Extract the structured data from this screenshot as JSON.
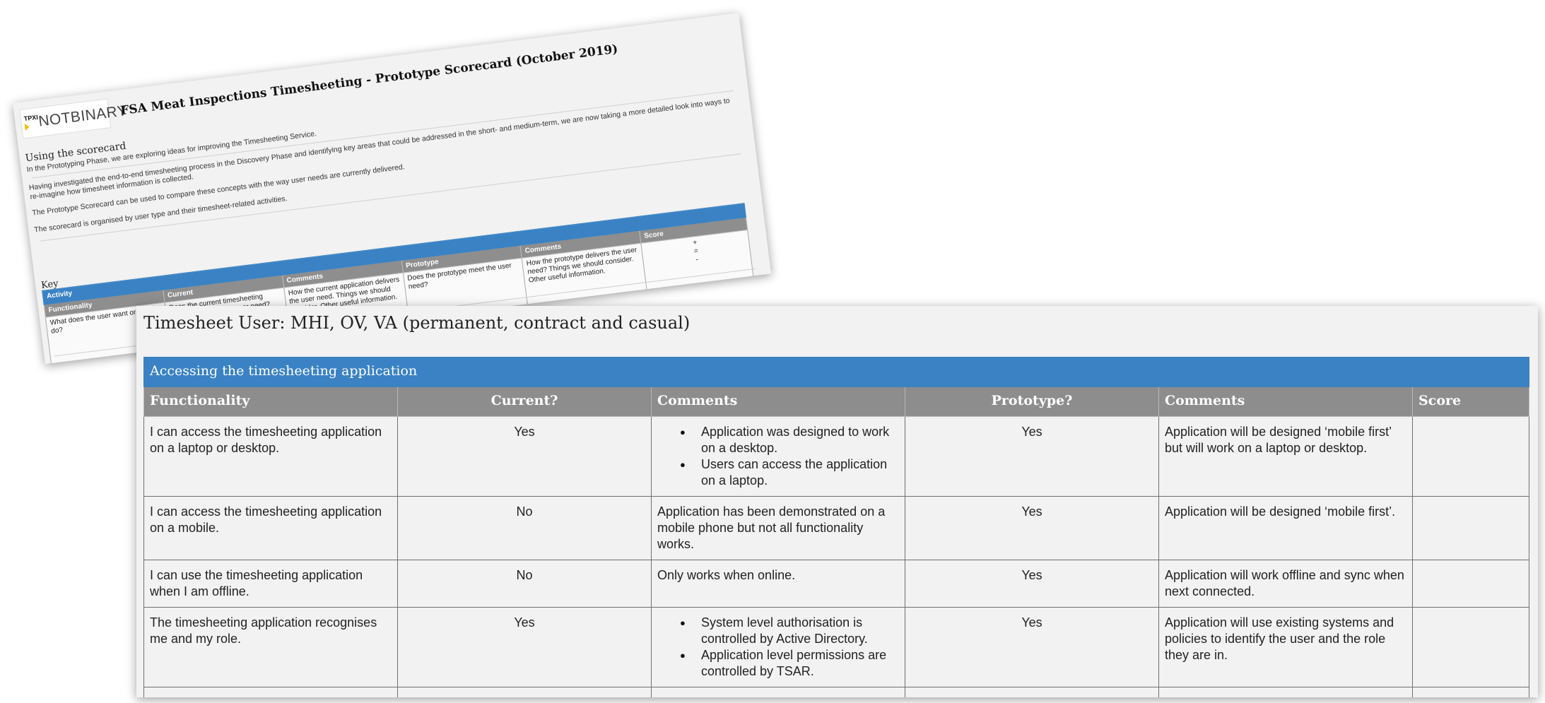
{
  "back_doc": {
    "logo_tpx": "TPXI",
    "logo_wordmark": "NOTBINARY",
    "title": "FSA Meat Inspections Timesheeting - Prototype Scorecard (October 2019)",
    "using_heading": "Using the scorecard",
    "paragraphs": [
      "In the Prototyping Phase, we are exploring ideas for improving the Timesheeting Service.",
      "Having investigated the end-to-end timesheeting process in the Discovery Phase and identifying key areas that could be addressed in the short- and medium-term, we are now taking a more detailed look into ways to re-imagine how timesheet information is collected.",
      "The Prototype Scorecard can be used to compare these concepts with the way user needs are currently delivered.",
      "The scorecard is organised by user type and their timesheet-related activities."
    ],
    "key_heading": "Key",
    "key_table": {
      "activity": "Activity",
      "score_header": "Score",
      "headers": [
        "Functionality",
        "Current",
        "Comments",
        "Prototype",
        "Comments"
      ],
      "body": [
        "What does the user want or need to do?",
        "Does the current timesheeting application meet the user need?",
        "How the current application delivers the user need. Things we should consider. Other useful information.",
        "Does the prototype meet the user need?",
        "How the prototype delivers the user need? Things we should consider. Other useful information."
      ],
      "score_symbols": [
        "+",
        "=",
        "-"
      ]
    }
  },
  "front_doc": {
    "section_title": "Timesheet User: MHI, OV, VA (permanent, contract and casual)",
    "activity": "Accessing the timesheeting application",
    "headers": {
      "functionality": "Functionality",
      "current": "Current?",
      "comments1": "Comments",
      "prototype": "Prototype?",
      "comments2": "Comments",
      "score": "Score"
    },
    "rows": [
      {
        "functionality": "I can access the timesheeting application on a laptop or desktop.",
        "current": "Yes",
        "current_comments": [
          "Application was designed to work on a desktop.",
          "Users can access the application on a laptop."
        ],
        "prototype": "Yes",
        "prototype_comments": "Application will be designed ‘mobile first’ but will work on a laptop or desktop.",
        "score": ""
      },
      {
        "functionality": "I can access the timesheeting application on a mobile.",
        "current": "No",
        "current_comments": "Application has been demonstrated on a mobile phone but not all functionality works.",
        "prototype": "Yes",
        "prototype_comments": "Application will be designed ‘mobile first’.",
        "score": ""
      },
      {
        "functionality": "I can use the timesheeting application when I am offline.",
        "current": "No",
        "current_comments": "Only works when online.",
        "prototype": "Yes",
        "prototype_comments": "Application will work offline and sync when next connected.",
        "score": ""
      },
      {
        "functionality": "The timesheeting application recognises me and my role.",
        "current": "Yes",
        "current_comments": [
          "System level authorisation is controlled by Active Directory.",
          "Application level permissions are controlled by TSAR."
        ],
        "prototype": "Yes",
        "prototype_comments": "Application will use existing systems and policies to identify the user and the role they are in.",
        "score": ""
      }
    ]
  },
  "colors": {
    "header_blue": "#3a82c4",
    "header_grey": "#8d8d8d",
    "page_bg": "#f2f2f2"
  }
}
